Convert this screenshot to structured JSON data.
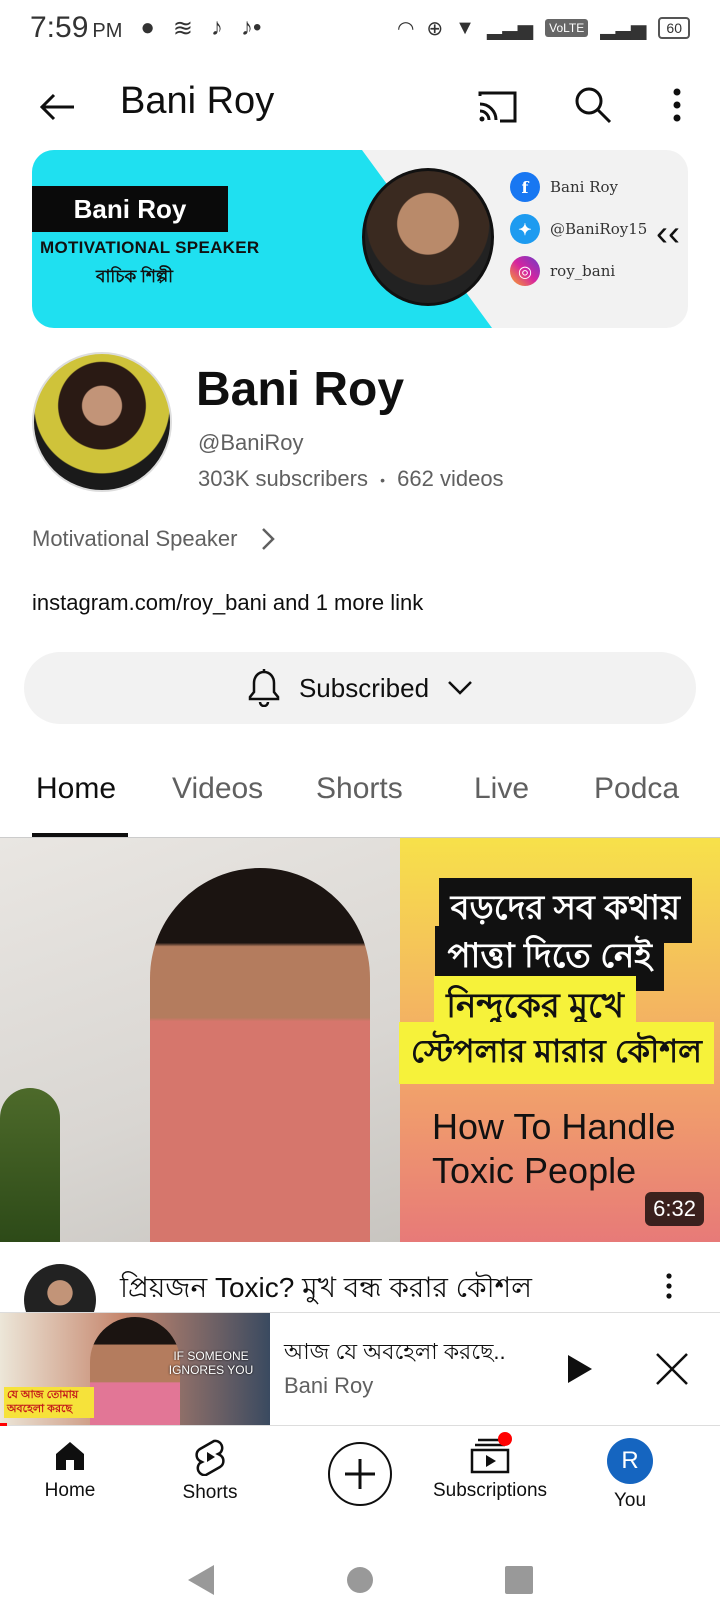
{
  "status_bar": {
    "time": "7:59",
    "ampm": "PM",
    "volte": "VoLTE",
    "battery": "60"
  },
  "app_bar": {
    "title": "Bani Roy"
  },
  "banner": {
    "name": "Bani Roy",
    "role": "MOTIVATIONAL SPEAKER",
    "subtitle": "বাচিক শিল্পী",
    "social": [
      {
        "platform": "facebook",
        "label": "Bani Roy",
        "color": "#1877f2"
      },
      {
        "platform": "twitter",
        "label": "@BaniRoy15",
        "color": "#1d9bf0"
      },
      {
        "platform": "instagram",
        "label": "roy_bani",
        "color": "#d6249f"
      }
    ]
  },
  "channel": {
    "name": "Bani Roy",
    "handle": "@BaniRoy",
    "subscribers": "303K subscribers",
    "separator": "•",
    "videos": "662 videos",
    "description": "Motivational Speaker",
    "links": "instagram.com/roy_bani and 1 more link",
    "subscribe_label": "Subscribed"
  },
  "tabs": [
    {
      "label": "Home",
      "active": true
    },
    {
      "label": "Videos",
      "active": false
    },
    {
      "label": "Shorts",
      "active": false
    },
    {
      "label": "Live",
      "active": false
    },
    {
      "label": "Podca",
      "active": false
    }
  ],
  "featured_video": {
    "thumb_lines_bn": [
      "বড়দের সব কথায়",
      "পাত্তা দিতে নেই",
      "নিন্দুকের মুখে",
      "স্টেপলার মারার কৌশল"
    ],
    "thumb_lines_en": [
      "How To Handle",
      "Toxic People"
    ],
    "duration": "6:32",
    "title": "প্রিয়জন Toxic? মুখ বন্ধ করার কৌশল"
  },
  "mini_player": {
    "title": "আজ যে অবহেলা করছে..",
    "channel": "Bani Roy",
    "thumb_text_en": "IF SOMEONE IGNORES YOU",
    "thumb_text_bn": "যে আজ তোমায় অবহেলা করছে",
    "progress": 0.01
  },
  "bottom_nav": [
    {
      "label": "Home",
      "icon": "home-icon"
    },
    {
      "label": "Shorts",
      "icon": "shorts-icon"
    },
    {
      "label": "",
      "icon": "create-icon"
    },
    {
      "label": "Subscriptions",
      "icon": "subscriptions-icon"
    },
    {
      "label": "You",
      "icon": "avatar",
      "initial": "R"
    }
  ],
  "colors": {
    "accent_red": "#ff0000",
    "banner_cyan": "#1fe0f0",
    "avatar_blue": "#1565c0"
  }
}
